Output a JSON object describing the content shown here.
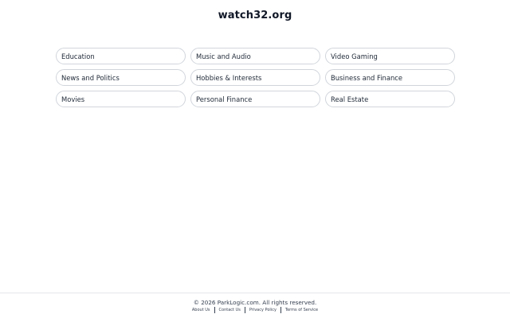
{
  "header": {
    "title": "watch32.org"
  },
  "categories": [
    {
      "label": "Education"
    },
    {
      "label": "Music and Audio"
    },
    {
      "label": "Video Gaming"
    },
    {
      "label": "News and Politics"
    },
    {
      "label": "Hobbies & Interests"
    },
    {
      "label": "Business and Finance"
    },
    {
      "label": "Movies"
    },
    {
      "label": "Personal Finance"
    },
    {
      "label": "Real Estate"
    }
  ],
  "footer": {
    "copyright": "© 2026 ParkLogic.com. All rights reserved.",
    "links": [
      {
        "label": "About Us"
      },
      {
        "label": "Contact Us"
      },
      {
        "label": "Privacy Policy"
      },
      {
        "label": "Terms of Service"
      }
    ]
  },
  "colors": {
    "pill_border": "#d1d5db",
    "text": "#1f2937",
    "background": "#ffffff"
  }
}
